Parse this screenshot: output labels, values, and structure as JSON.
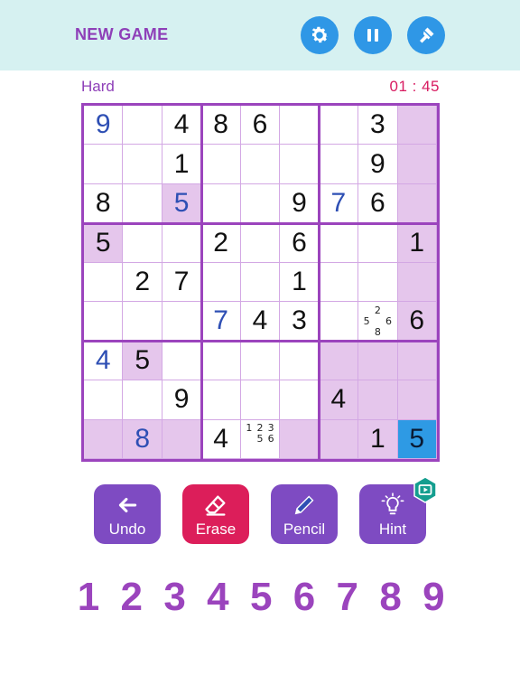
{
  "header": {
    "new_game_label": "NEW GAME",
    "icons": [
      "gear-icon",
      "pause-icon",
      "paint-brush-icon"
    ]
  },
  "status": {
    "difficulty": "Hard",
    "timer": "01 : 45"
  },
  "colors": {
    "accent": "#9b44bd",
    "header_bg": "#d6f1f1",
    "button_blue": "#2f97e6",
    "highlight": "#e5c6ec",
    "selected": "#2e9ae4",
    "user_digit": "#2e4fb4",
    "erase": "#dc1e5a",
    "tool": "#7e4bc2",
    "timer": "#d81b60"
  },
  "board": {
    "rows": [
      [
        "9",
        "",
        "4",
        "8",
        "6",
        "",
        "",
        "3",
        ""
      ],
      [
        "",
        "",
        "1",
        "",
        "",
        "",
        "",
        "9",
        ""
      ],
      [
        "8",
        "",
        "5",
        "",
        "",
        "9",
        "7",
        "6",
        ""
      ],
      [
        "5",
        "",
        "",
        "2",
        "",
        "6",
        "",
        "",
        "1"
      ],
      [
        "",
        "2",
        "7",
        "",
        "",
        "1",
        "",
        "",
        ""
      ],
      [
        "",
        "",
        "",
        "7",
        "4",
        "3",
        "",
        "",
        "6"
      ],
      [
        "4",
        "5",
        "",
        "",
        "",
        "",
        "",
        "",
        ""
      ],
      [
        "",
        "",
        "9",
        "",
        "",
        "",
        "4",
        "",
        ""
      ],
      [
        "",
        "8",
        "",
        "4",
        "",
        "",
        "",
        "1",
        "5"
      ]
    ],
    "user_entered": [
      "0,0",
      "2,2",
      "2,6",
      "5,3",
      "6,0",
      "8,1"
    ],
    "highlighted": [
      "0,8",
      "1,8",
      "2,2",
      "2,8",
      "3,0",
      "3,8",
      "4,8",
      "5,8",
      "6,1",
      "6,6",
      "6,7",
      "6,8",
      "7,6",
      "7,7",
      "7,8",
      "8,0",
      "8,1",
      "8,2",
      "8,5",
      "8,6",
      "8,7"
    ],
    "selected": "8,8",
    "notes": [
      {
        "cell": "5,7",
        "grid": [
          "",
          "2",
          "",
          "5",
          "",
          "6",
          "",
          "8",
          ""
        ]
      },
      {
        "cell": "8,4",
        "grid": [
          "1",
          "2",
          "3",
          "",
          "5",
          "6",
          "",
          "",
          ""
        ]
      }
    ]
  },
  "tools": [
    {
      "label": "Undo",
      "icon": "undo-arrow-icon"
    },
    {
      "label": "Erase",
      "icon": "eraser-icon"
    },
    {
      "label": "Pencil",
      "icon": "pencil-icon"
    },
    {
      "label": "Hint",
      "icon": "lightbulb-icon"
    }
  ],
  "hint_badge_icon": "video-ad-icon",
  "numpad": [
    "1",
    "2",
    "3",
    "4",
    "5",
    "6",
    "7",
    "8",
    "9"
  ]
}
